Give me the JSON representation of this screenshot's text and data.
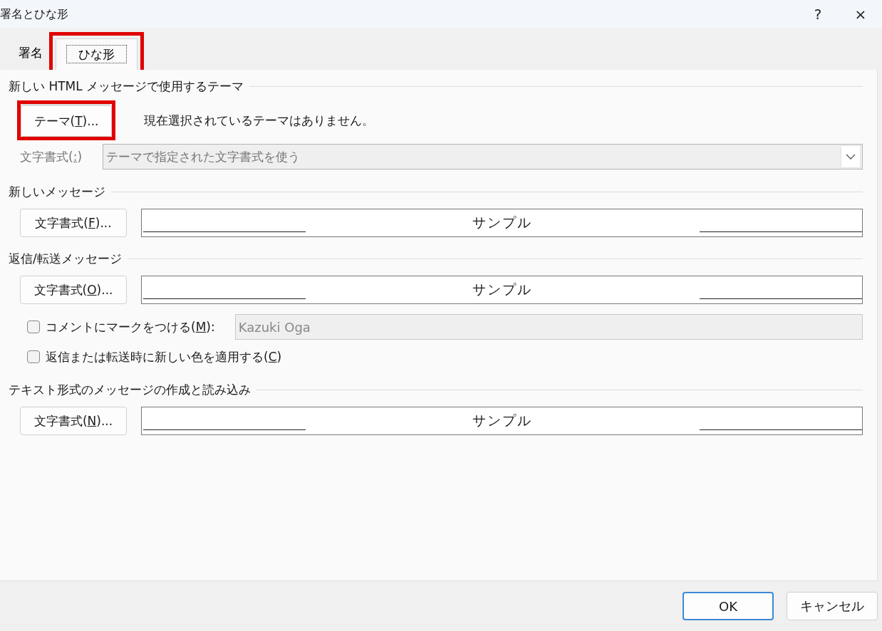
{
  "window": {
    "title": "署名とひな形",
    "help": "?",
    "close": "×"
  },
  "tabs": [
    {
      "label": "署名",
      "selected": false,
      "highlighted": false
    },
    {
      "label": "ひな形",
      "selected": true,
      "highlighted": true
    }
  ],
  "theme_group": {
    "heading": "新しい HTML メッセージで使用するテーマ",
    "theme_button": {
      "text_before": "テーマ(",
      "access_key": "T",
      "text_after": ")...",
      "highlighted": true
    },
    "status": "現在選択されているテーマはありません。",
    "font_label": {
      "text_before": "文字書式(",
      "access_key": ":",
      "text_after": ")"
    },
    "font_select": {
      "value": "テーマで指定された文字書式を使う",
      "disabled": true
    }
  },
  "sections": [
    {
      "kind": "font",
      "heading": "新しいメッセージ",
      "button": {
        "text_before": "文字書式(",
        "access_key": "F",
        "text_after": ")..."
      },
      "sample": "サンプル"
    },
    {
      "kind": "font",
      "heading": "返信/転送メッセージ",
      "button": {
        "text_before": "文字書式(",
        "access_key": "O",
        "text_after": ")..."
      },
      "sample": "サンプル"
    },
    {
      "kind": "options",
      "options": [
        {
          "text_before": "コメントにマークをつける(",
          "access_key": "M",
          "text_after": "):",
          "checked": false,
          "field": {
            "value": "Kazuki Oga",
            "disabled": true
          }
        },
        {
          "text_before": "返信または転送時に新しい色を適用する(",
          "access_key": "C",
          "text_after": ")",
          "checked": false
        }
      ]
    },
    {
      "kind": "font",
      "heading": "テキスト形式のメッセージの作成と読み込み",
      "button": {
        "text_before": "文字書式(",
        "access_key": "N",
        "text_after": ")..."
      },
      "sample": "サンプル"
    }
  ],
  "buttons": [
    {
      "label": "OK",
      "default": true
    },
    {
      "label": "キャンセル",
      "default": false
    }
  ]
}
